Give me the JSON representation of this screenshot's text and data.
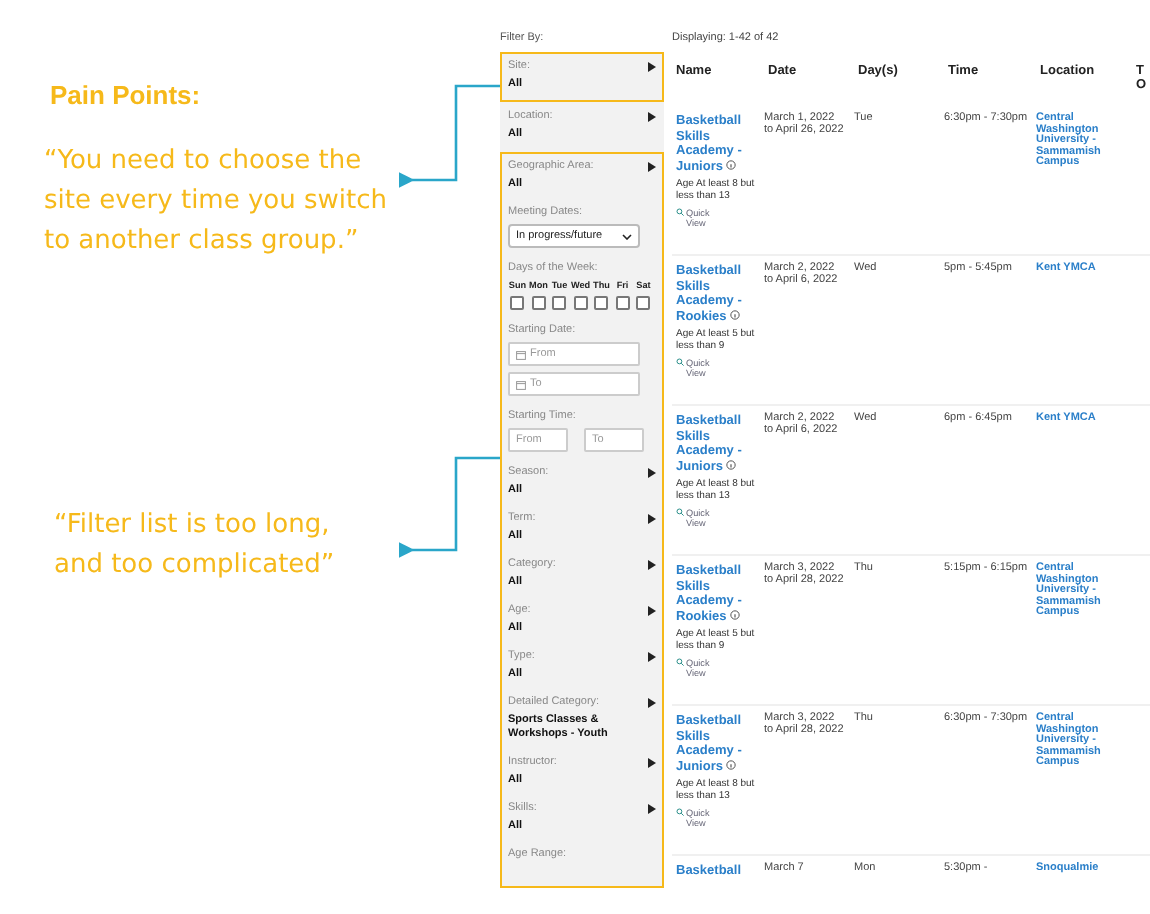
{
  "annotations": {
    "heading": "Pain Points:",
    "notes": [
      {
        "text": "“You need to choose the site every time you switch to another class group.”"
      },
      {
        "text": "“Filter list is too long, and too complicated”"
      }
    ]
  },
  "filter_panel": {
    "title": "Filter By:",
    "groups": [
      {
        "highlighted": true,
        "filters": [
          {
            "kind": "select",
            "label": "Site:",
            "value": "All"
          }
        ]
      },
      {
        "highlighted": false,
        "filters": [
          {
            "kind": "select",
            "label": "Location:",
            "value": "All"
          }
        ]
      },
      {
        "highlighted": true,
        "filters": [
          {
            "kind": "select",
            "label": "Geographic Area:",
            "value": "All"
          },
          {
            "kind": "dropdown",
            "label": "Meeting Dates:",
            "value": "In progress/future"
          },
          {
            "kind": "days",
            "label": "Days of the Week:",
            "days": [
              {
                "label": "Sun",
                "checked": false
              },
              {
                "label": "Mon",
                "checked": false
              },
              {
                "label": "Tue",
                "checked": false
              },
              {
                "label": "Wed",
                "checked": false
              },
              {
                "label": "Thu",
                "checked": false
              },
              {
                "label": "Fri",
                "checked": false
              },
              {
                "label": "Sat",
                "checked": false
              }
            ]
          },
          {
            "kind": "date_range",
            "label": "Starting Date:",
            "from": "From",
            "to": "To"
          },
          {
            "kind": "time_range",
            "label": "Starting Time:",
            "from": "From",
            "to": "To"
          },
          {
            "kind": "select",
            "label": "Season:",
            "value": "All"
          },
          {
            "kind": "select",
            "label": "Term:",
            "value": "All"
          },
          {
            "kind": "select",
            "label": "Category:",
            "value": "All"
          },
          {
            "kind": "select",
            "label": "Age:",
            "value": "All"
          },
          {
            "kind": "select",
            "label": "Type:",
            "value": "All"
          },
          {
            "kind": "select",
            "label": "Detailed Category:",
            "value": "Sports Classes & Workshops - Youth"
          },
          {
            "kind": "select",
            "label": "Instructor:",
            "value": "All"
          },
          {
            "kind": "select",
            "label": "Skills:",
            "value": "All"
          },
          {
            "kind": "heading",
            "label": "Age Range:"
          }
        ]
      }
    ]
  },
  "results": {
    "summary": "Displaying: 1-42 of 42",
    "columns": [
      "Name",
      "Date",
      "Day(s)",
      "Time",
      "Location",
      "T O"
    ],
    "rows": [
      {
        "name": "Basketball Skills Academy - Juniors",
        "age": "Age At least 8 but less than 13",
        "quick_view": "Quick View",
        "date": "March 1, 2022 to April 26, 2022",
        "day": "Tue",
        "time": "6:30pm - 7:30pm",
        "location": "Central Washington University - Sammamish Campus"
      },
      {
        "name": "Basketball Skills Academy - Rookies",
        "age": "Age At least 5 but less than 9",
        "quick_view": "Quick View",
        "date": "March 2, 2022 to April 6, 2022",
        "day": "Wed",
        "time": "5pm - 5:45pm",
        "location": "Kent YMCA"
      },
      {
        "name": "Basketball Skills Academy - Juniors",
        "age": "Age At least 8 but less than 13",
        "quick_view": "Quick View",
        "date": "March 2, 2022 to April 6, 2022",
        "day": "Wed",
        "time": "6pm - 6:45pm",
        "location": "Kent YMCA"
      },
      {
        "name": "Basketball Skills Academy - Rookies",
        "age": "Age At least 5 but less than 9",
        "quick_view": "Quick View",
        "date": "March 3, 2022 to April 28, 2022",
        "day": "Thu",
        "time": "5:15pm - 6:15pm",
        "location": "Central Washington University - Sammamish Campus"
      },
      {
        "name": "Basketball Skills Academy - Juniors",
        "age": "Age At least 8 but less than 13",
        "quick_view": "Quick View",
        "date": "March 3, 2022 to April 28, 2022",
        "day": "Thu",
        "time": "6:30pm - 7:30pm",
        "location": "Central Washington University - Sammamish Campus"
      },
      {
        "name": "Basketball",
        "date": "March 7",
        "day": "Mon",
        "time": "5:30pm -",
        "location": "Snoqualmie"
      }
    ]
  }
}
